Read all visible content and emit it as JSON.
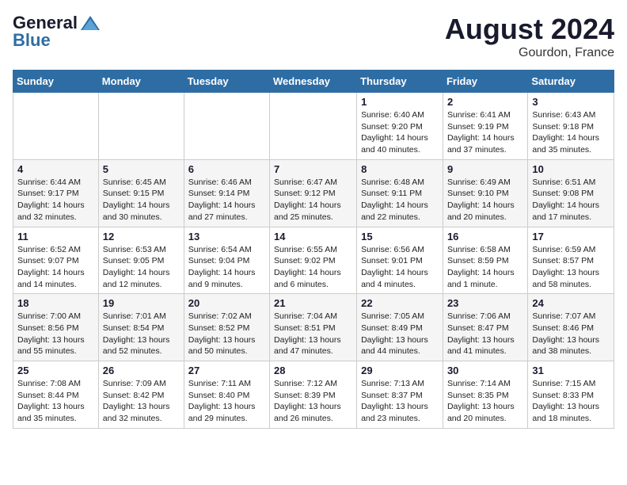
{
  "header": {
    "logo_general": "General",
    "logo_blue": "Blue",
    "month": "August 2024",
    "location": "Gourdon, France"
  },
  "weekdays": [
    "Sunday",
    "Monday",
    "Tuesday",
    "Wednesday",
    "Thursday",
    "Friday",
    "Saturday"
  ],
  "weeks": [
    [
      {
        "day": "",
        "info": ""
      },
      {
        "day": "",
        "info": ""
      },
      {
        "day": "",
        "info": ""
      },
      {
        "day": "",
        "info": ""
      },
      {
        "day": "1",
        "info": "Sunrise: 6:40 AM\nSunset: 9:20 PM\nDaylight: 14 hours and 40 minutes."
      },
      {
        "day": "2",
        "info": "Sunrise: 6:41 AM\nSunset: 9:19 PM\nDaylight: 14 hours and 37 minutes."
      },
      {
        "day": "3",
        "info": "Sunrise: 6:43 AM\nSunset: 9:18 PM\nDaylight: 14 hours and 35 minutes."
      }
    ],
    [
      {
        "day": "4",
        "info": "Sunrise: 6:44 AM\nSunset: 9:17 PM\nDaylight: 14 hours and 32 minutes."
      },
      {
        "day": "5",
        "info": "Sunrise: 6:45 AM\nSunset: 9:15 PM\nDaylight: 14 hours and 30 minutes."
      },
      {
        "day": "6",
        "info": "Sunrise: 6:46 AM\nSunset: 9:14 PM\nDaylight: 14 hours and 27 minutes."
      },
      {
        "day": "7",
        "info": "Sunrise: 6:47 AM\nSunset: 9:12 PM\nDaylight: 14 hours and 25 minutes."
      },
      {
        "day": "8",
        "info": "Sunrise: 6:48 AM\nSunset: 9:11 PM\nDaylight: 14 hours and 22 minutes."
      },
      {
        "day": "9",
        "info": "Sunrise: 6:49 AM\nSunset: 9:10 PM\nDaylight: 14 hours and 20 minutes."
      },
      {
        "day": "10",
        "info": "Sunrise: 6:51 AM\nSunset: 9:08 PM\nDaylight: 14 hours and 17 minutes."
      }
    ],
    [
      {
        "day": "11",
        "info": "Sunrise: 6:52 AM\nSunset: 9:07 PM\nDaylight: 14 hours and 14 minutes."
      },
      {
        "day": "12",
        "info": "Sunrise: 6:53 AM\nSunset: 9:05 PM\nDaylight: 14 hours and 12 minutes."
      },
      {
        "day": "13",
        "info": "Sunrise: 6:54 AM\nSunset: 9:04 PM\nDaylight: 14 hours and 9 minutes."
      },
      {
        "day": "14",
        "info": "Sunrise: 6:55 AM\nSunset: 9:02 PM\nDaylight: 14 hours and 6 minutes."
      },
      {
        "day": "15",
        "info": "Sunrise: 6:56 AM\nSunset: 9:01 PM\nDaylight: 14 hours and 4 minutes."
      },
      {
        "day": "16",
        "info": "Sunrise: 6:58 AM\nSunset: 8:59 PM\nDaylight: 14 hours and 1 minute."
      },
      {
        "day": "17",
        "info": "Sunrise: 6:59 AM\nSunset: 8:57 PM\nDaylight: 13 hours and 58 minutes."
      }
    ],
    [
      {
        "day": "18",
        "info": "Sunrise: 7:00 AM\nSunset: 8:56 PM\nDaylight: 13 hours and 55 minutes."
      },
      {
        "day": "19",
        "info": "Sunrise: 7:01 AM\nSunset: 8:54 PM\nDaylight: 13 hours and 52 minutes."
      },
      {
        "day": "20",
        "info": "Sunrise: 7:02 AM\nSunset: 8:52 PM\nDaylight: 13 hours and 50 minutes."
      },
      {
        "day": "21",
        "info": "Sunrise: 7:04 AM\nSunset: 8:51 PM\nDaylight: 13 hours and 47 minutes."
      },
      {
        "day": "22",
        "info": "Sunrise: 7:05 AM\nSunset: 8:49 PM\nDaylight: 13 hours and 44 minutes."
      },
      {
        "day": "23",
        "info": "Sunrise: 7:06 AM\nSunset: 8:47 PM\nDaylight: 13 hours and 41 minutes."
      },
      {
        "day": "24",
        "info": "Sunrise: 7:07 AM\nSunset: 8:46 PM\nDaylight: 13 hours and 38 minutes."
      }
    ],
    [
      {
        "day": "25",
        "info": "Sunrise: 7:08 AM\nSunset: 8:44 PM\nDaylight: 13 hours and 35 minutes."
      },
      {
        "day": "26",
        "info": "Sunrise: 7:09 AM\nSunset: 8:42 PM\nDaylight: 13 hours and 32 minutes."
      },
      {
        "day": "27",
        "info": "Sunrise: 7:11 AM\nSunset: 8:40 PM\nDaylight: 13 hours and 29 minutes."
      },
      {
        "day": "28",
        "info": "Sunrise: 7:12 AM\nSunset: 8:39 PM\nDaylight: 13 hours and 26 minutes."
      },
      {
        "day": "29",
        "info": "Sunrise: 7:13 AM\nSunset: 8:37 PM\nDaylight: 13 hours and 23 minutes."
      },
      {
        "day": "30",
        "info": "Sunrise: 7:14 AM\nSunset: 8:35 PM\nDaylight: 13 hours and 20 minutes."
      },
      {
        "day": "31",
        "info": "Sunrise: 7:15 AM\nSunset: 8:33 PM\nDaylight: 13 hours and 18 minutes."
      }
    ]
  ]
}
